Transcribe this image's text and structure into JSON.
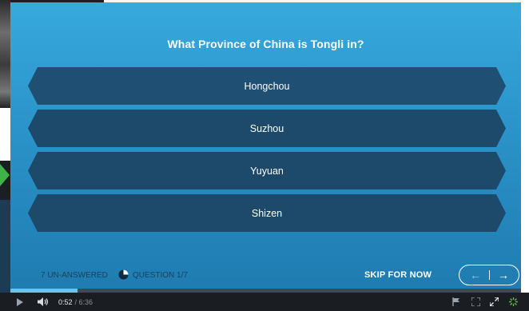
{
  "quiz": {
    "question": "What Province of China is Tongli in?",
    "answers": [
      "Hongchou",
      "Suzhou",
      "Yuyuan",
      "Shizen"
    ]
  },
  "footer": {
    "unanswered": "7 UN-ANSWERED",
    "question_counter": "QUESTION 1/7",
    "skip_label": "SKIP FOR NOW",
    "prev_icon": "arrow-left-icon",
    "next_icon": "arrow-right-icon"
  },
  "player": {
    "current_time": "0:52",
    "total_time": "/ 6:36",
    "progress_fraction": 0.131
  },
  "colors": {
    "panel_top": "#37a9dc",
    "panel_bottom": "#1f7bb0",
    "answer": "#1d4a6b",
    "footer_text": "#1c3f5a",
    "progress_fill": "#6fc3e8"
  }
}
